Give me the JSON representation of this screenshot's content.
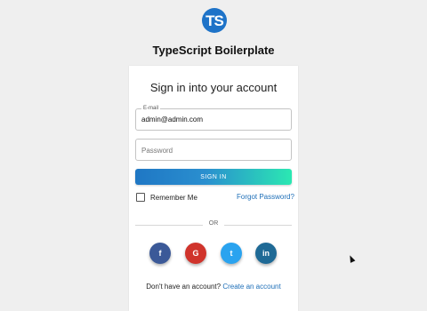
{
  "app": {
    "logo_text": "TS",
    "title": "TypeScript Boilerplate"
  },
  "login": {
    "heading": "Sign in into your account",
    "email_label": "E-mail",
    "email_value": "admin@admin.com",
    "password_placeholder": "Password",
    "signin_label": "SIGN IN",
    "remember_label": "Remember Me",
    "remember_checked": false,
    "forgot_label": "Forgot Password?",
    "or_label": "OR",
    "signup_prompt": "Don't have an account?",
    "signup_link": "Create an account"
  },
  "social": [
    {
      "name": "facebook",
      "glyph": "f",
      "color": "#3b5998"
    },
    {
      "name": "google",
      "glyph": "G",
      "color": "#d0342c"
    },
    {
      "name": "twitter",
      "glyph": "t",
      "color": "#2aa3ef"
    },
    {
      "name": "linkedin",
      "glyph": "in",
      "color": "#1f6a96"
    }
  ],
  "colors": {
    "accent": "#1e73c8",
    "link": "#1e6fb8",
    "button_gradient_start": "#1f77c4",
    "button_gradient_end": "#2be8b2"
  }
}
